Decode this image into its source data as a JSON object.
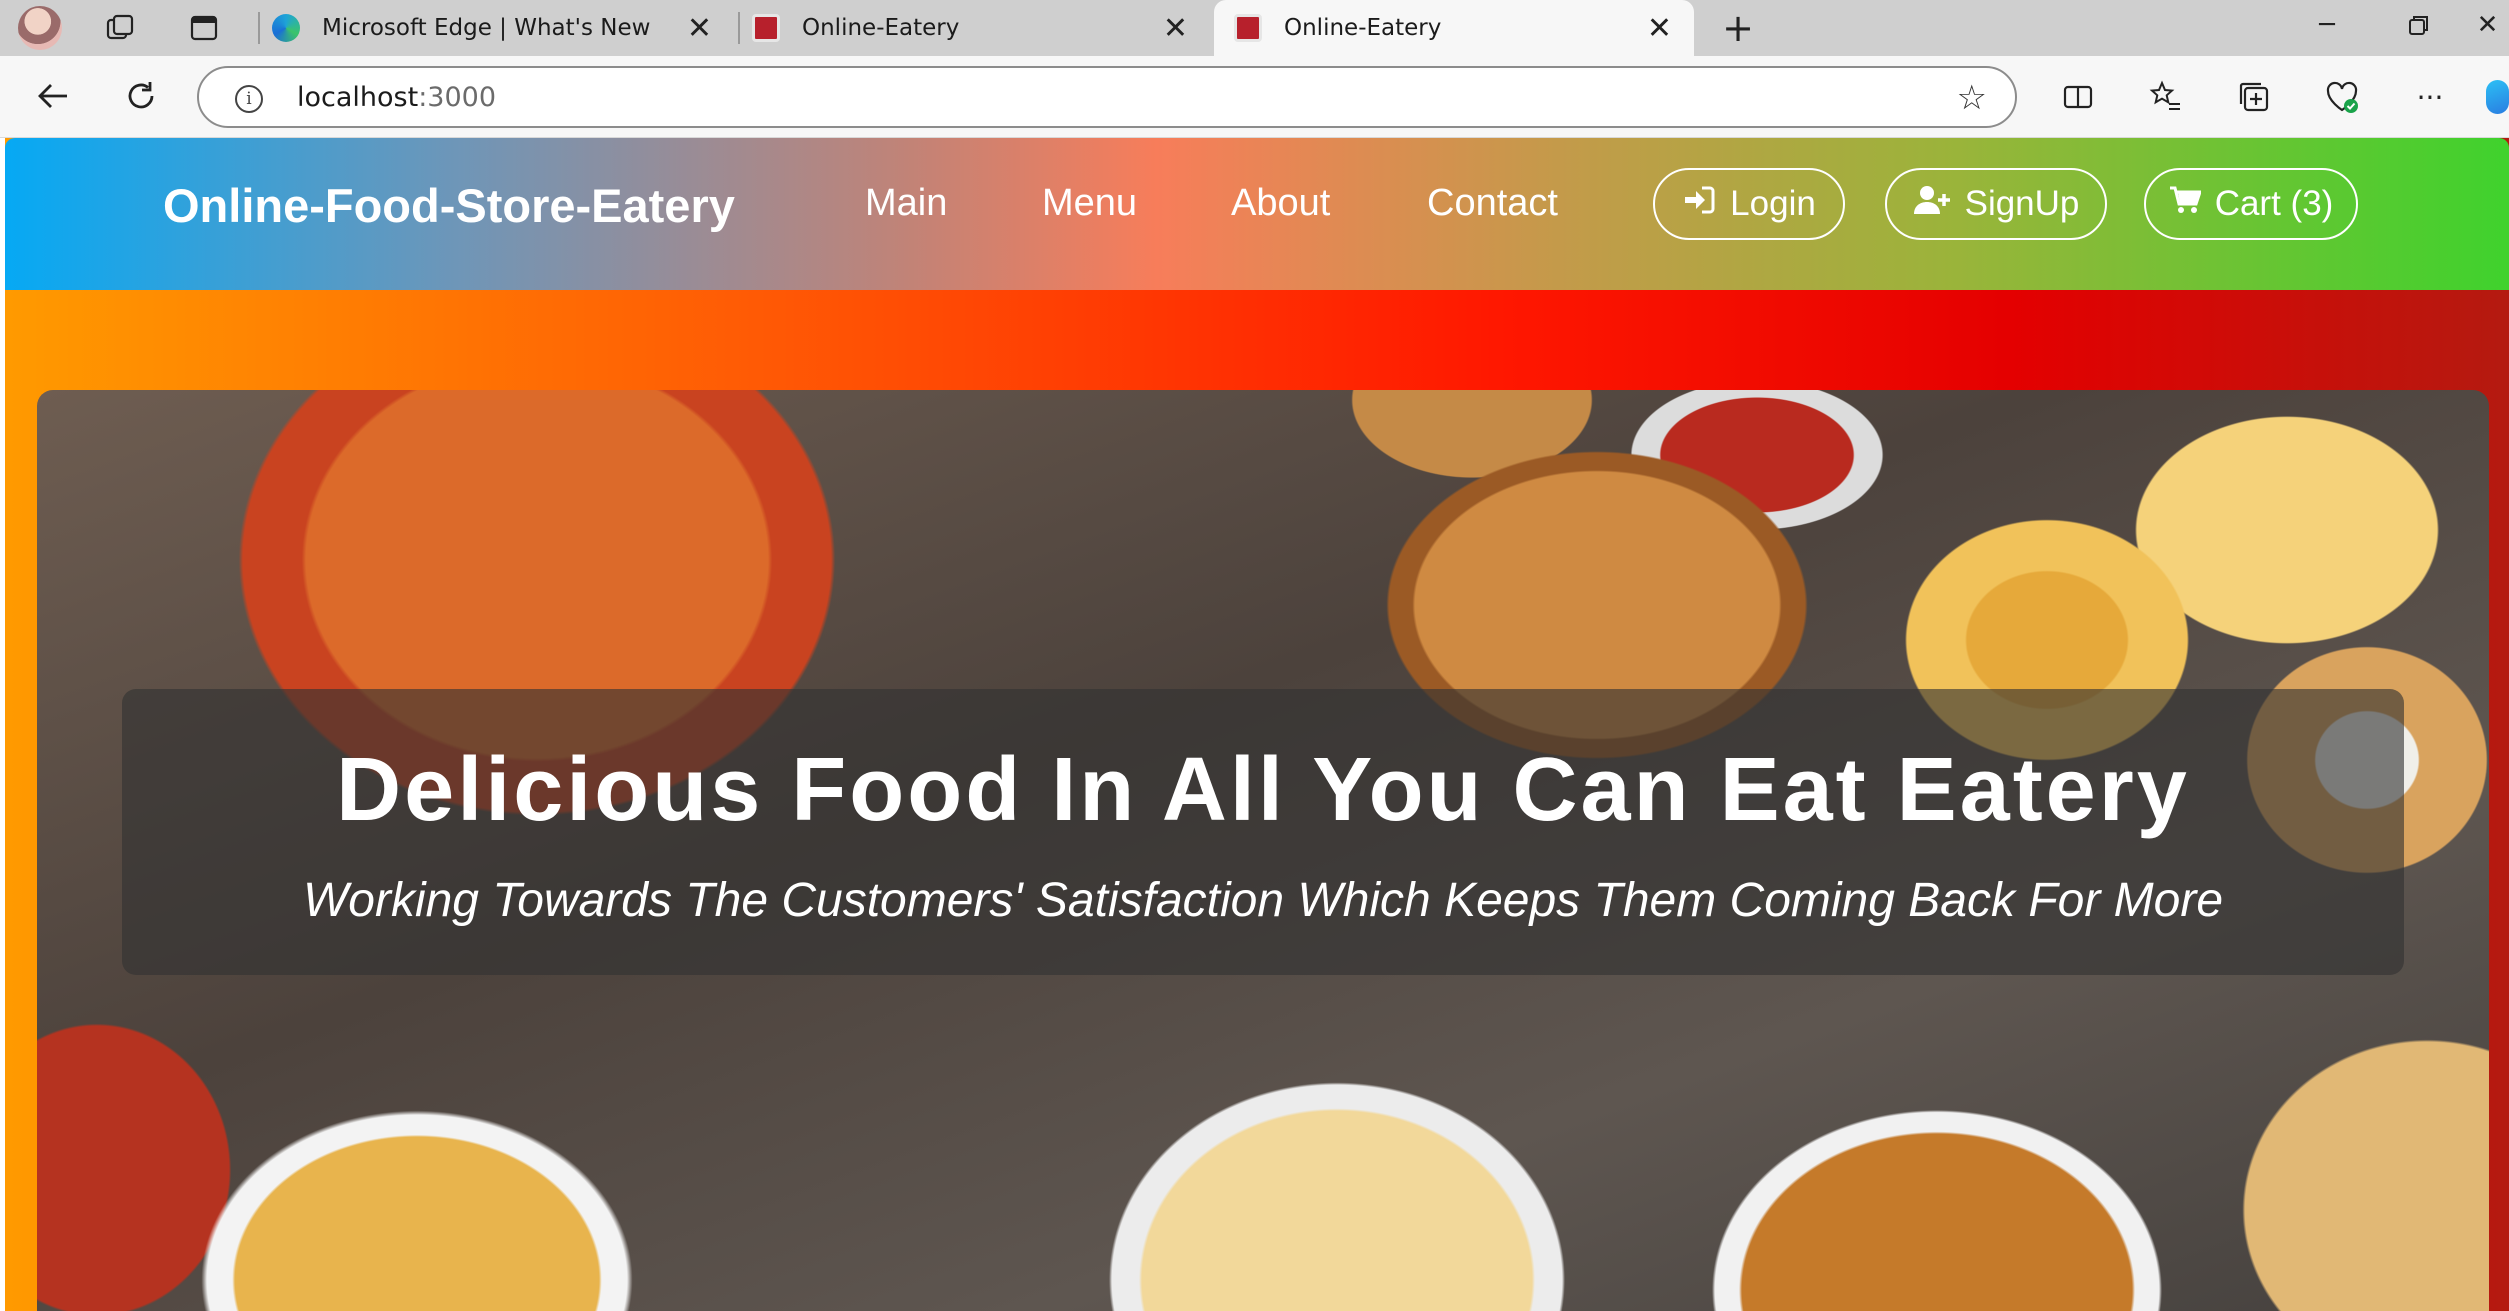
{
  "browser": {
    "tabs": [
      {
        "title": "Microsoft Edge | What's New",
        "active": false
      },
      {
        "title": "Online-Eatery",
        "active": false
      },
      {
        "title": "Online-Eatery",
        "active": true
      }
    ],
    "new_tab_label": "+",
    "address": {
      "host": "localhost",
      "port": ":3000"
    },
    "icons": {
      "back": "back-arrow-icon",
      "refresh": "refresh-icon",
      "info": "info-icon",
      "favorite": "star-icon"
    }
  },
  "site": {
    "brand": "Online-Food-Store-Eatery",
    "nav": [
      "Main",
      "Menu",
      "About",
      "Contact"
    ],
    "buttons": {
      "login": "Login",
      "signup": "SignUp",
      "cart": "Cart (3)"
    },
    "colors": {
      "navbar_start": "#06a9f4",
      "navbar_end": "#3fd22d",
      "page_start": "#ff9a00",
      "page_end": "#b41a10"
    }
  },
  "hero": {
    "title": "Delicious Food In All You Can Eat Eatery",
    "subtitle": "Working Towards The Customers' Satisfaction Which Keeps Them Coming Back For More"
  }
}
